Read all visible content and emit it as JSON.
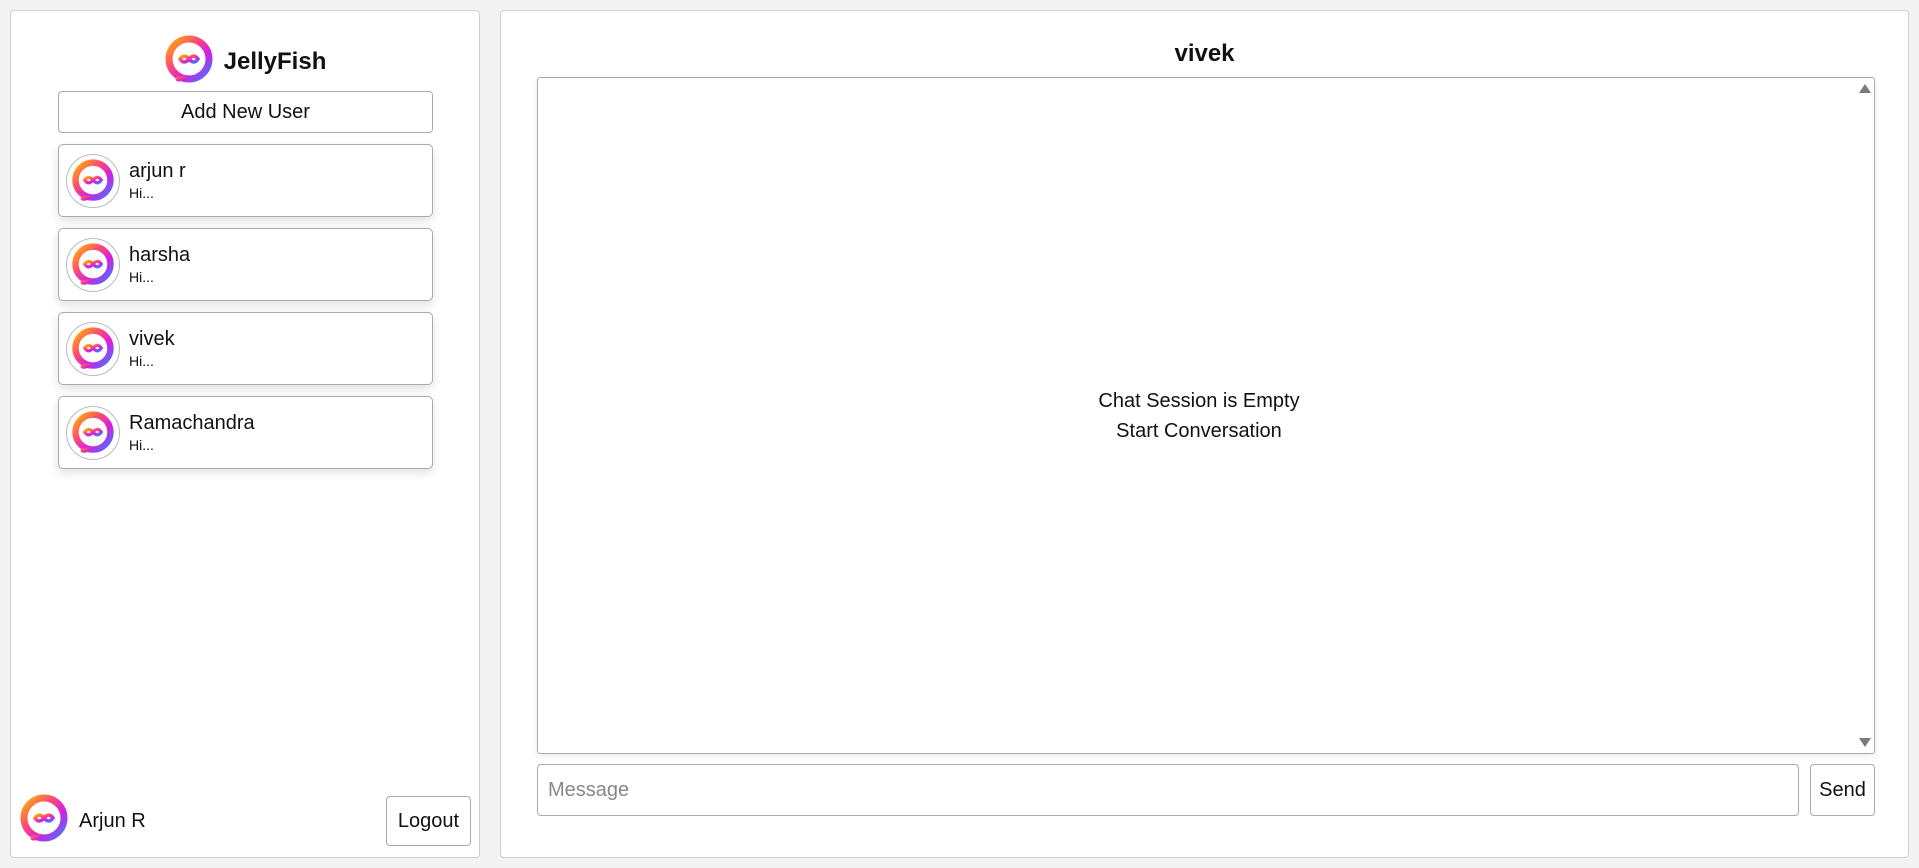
{
  "app": {
    "name": "JellyFish",
    "logo_icon": "jellyfish-logo-icon"
  },
  "sidebar": {
    "add_user_label": "Add New User",
    "users": [
      {
        "name": "arjun r",
        "preview": "Hi..."
      },
      {
        "name": "harsha",
        "preview": "Hi..."
      },
      {
        "name": "vivek",
        "preview": "Hi..."
      },
      {
        "name": "Ramachandra",
        "preview": "Hi..."
      }
    ],
    "current_user": "Arjun R",
    "logout_label": "Logout"
  },
  "chat": {
    "title": "vivek",
    "empty_line1": "Chat Session is Empty",
    "empty_line2": "Start Conversation",
    "message_placeholder": "Message",
    "message_value": "",
    "send_label": "Send"
  },
  "colors": {
    "logo_gradient": [
      "#ff6a3d",
      "#e21ee6",
      "#3b7bff",
      "#ffb400"
    ]
  }
}
